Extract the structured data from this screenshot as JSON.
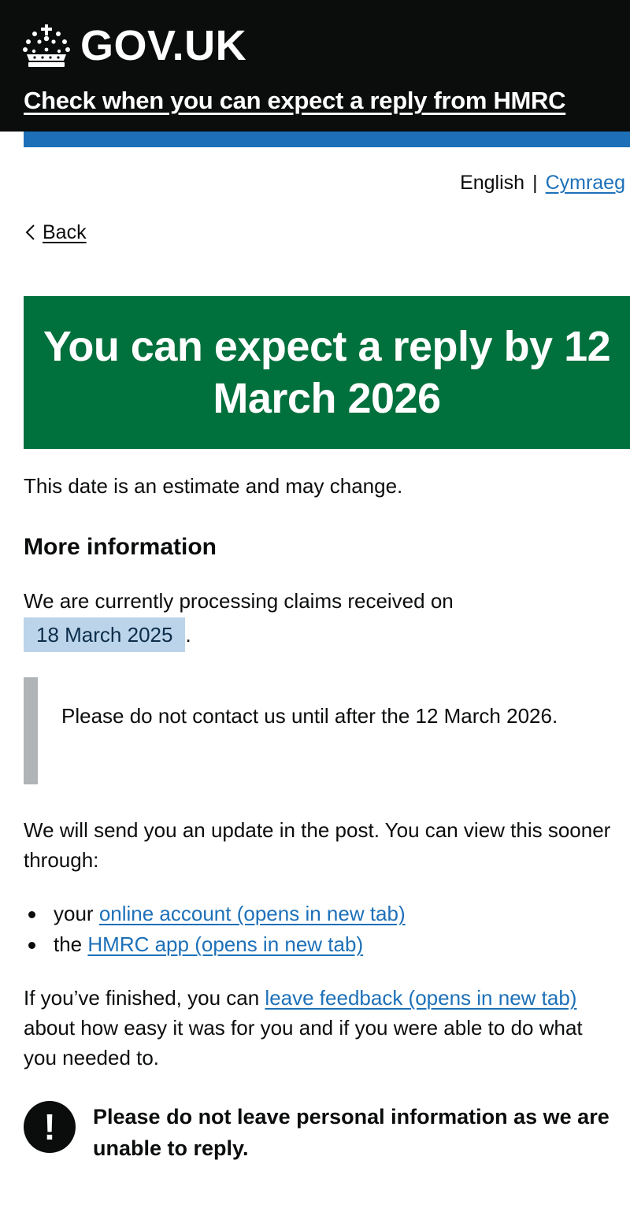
{
  "header": {
    "logo_text": "GOV.UK",
    "logo_icon": "crown-icon",
    "service_name": "Check when you can expect a reply from HMRC",
    "colors": {
      "header_bg": "#0b0c0c",
      "accent_bar": "#1d70b8"
    }
  },
  "language": {
    "current": "English",
    "separator": "|",
    "alternate": "Cymraeg"
  },
  "back": {
    "label": "Back",
    "icon": "chevron-left-icon"
  },
  "panel": {
    "title": "You can expect a reply by 12 March 2026",
    "color": "#00703c"
  },
  "content": {
    "estimate_note": "This date is an estimate and may change.",
    "more_info_heading": "More information",
    "processing_text": "We are currently processing claims received on",
    "processing_date": "18 March 2025",
    "processing_end": ".",
    "inset_text": "Please do not contact us until after the 12 March 2026.",
    "update_text": "We will send you an update in the post. You can view this sooner through:",
    "list": [
      {
        "prefix": "your",
        "link": "online account (opens in new tab)"
      },
      {
        "prefix": "the",
        "link": "HMRC app (opens in new tab)"
      }
    ],
    "feedback_prefix": "If you’ve finished, you can",
    "feedback_link": "leave feedback (opens in new tab)",
    "feedback_suffix": "about how easy it was for you and if you were able to do what you needed to."
  },
  "warning": {
    "icon": "exclamation-icon",
    "icon_glyph": "!",
    "text": "Please do not leave personal information as we are unable to reply."
  }
}
